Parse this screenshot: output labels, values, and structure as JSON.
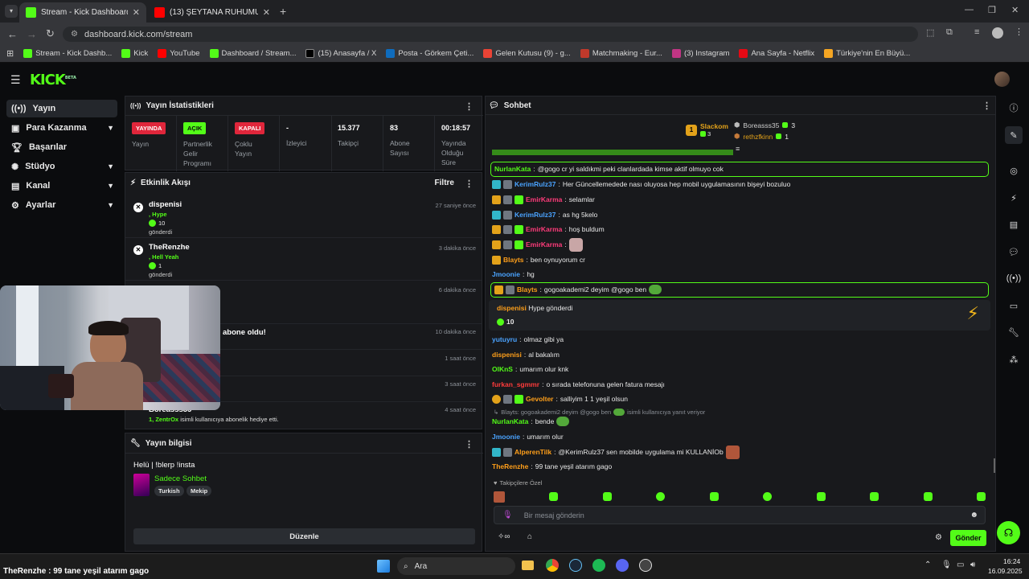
{
  "browser": {
    "tabs": [
      {
        "title": "Stream - Kick Dashboard",
        "active": true
      },
      {
        "title": "(13) ŞEYTANA RUHUMUZU SAT",
        "active": false
      }
    ],
    "url": "dashboard.kick.com/stream",
    "bookmarks": [
      "Stream - Kick Dashb...",
      "Kick",
      "YouTube",
      "Dashboard / Stream...",
      "(15) Anasayfa / X",
      "Posta - Görkem Çeti...",
      "Gelen Kutusu (9) - g...",
      "Matchmaking - Eur...",
      "(3) Instagram",
      "Ana Sayfa - Netflix",
      "Türkiye'nin En Büyü..."
    ]
  },
  "kick": {
    "logo": "KICK",
    "logo_tag": "BETA",
    "colors": {
      "accent": "#53fc18",
      "live": "#e0263b",
      "bg": "#0b0c0e",
      "panel": "#18191c"
    }
  },
  "sidebar": {
    "items": [
      {
        "label": "Yayın",
        "icon": "broadcast-icon"
      },
      {
        "label": "Para Kazanma",
        "icon": "money-icon"
      },
      {
        "label": "Başarılar",
        "icon": "trophy-icon"
      },
      {
        "label": "Stüdyo",
        "icon": "studio-icon"
      },
      {
        "label": "Kanal",
        "icon": "channel-icon"
      },
      {
        "label": "Ayarlar",
        "icon": "gear-icon"
      }
    ]
  },
  "stats": {
    "title": "Yayın İstatistikleri",
    "items": [
      {
        "value": "YAYINDA",
        "label": "Yayın"
      },
      {
        "value": "AÇIK",
        "label": "Partnerlik Gelir Programı"
      },
      {
        "value": "KAPALI",
        "label": "Çoklu Yayın"
      },
      {
        "value": "-",
        "label": "İzleyici"
      },
      {
        "value": "15.377",
        "label": "Takipçi"
      },
      {
        "value": "83",
        "label": "Abone Sayısı"
      },
      {
        "value": "00:18:57",
        "label": "Yayında Olduğu Süre"
      }
    ]
  },
  "activity": {
    "title": "Etkinlik Akışı",
    "filter": "Filtre",
    "events": [
      {
        "name": "dispenisi",
        "emote": ", Hype",
        "amount": "10",
        "sent": "gönderdi",
        "time": "27 saniye önce"
      },
      {
        "name": "TheRenzhe",
        "emote": ", Hell Yeah",
        "amount": "1",
        "sent": "gönderdi",
        "time": "3 dakika önce"
      },
      {
        "time": "6 dakika önce"
      },
      {
        "text": "abone oldu!",
        "time": "10 dakika önce"
      },
      {
        "time": "1 saat önce"
      },
      {
        "time": "3 saat önce"
      },
      {
        "name": "Boreasss35",
        "gift_text": "isimli kullanıcıya abonelik hediye etti.",
        "gift_prefix": "1, ZentrOx",
        "time": "4 saat önce"
      }
    ]
  },
  "info": {
    "title": "Yayın bilgisi",
    "stream_title": "Helü | !blerp !insta",
    "category": "Sadece Sohbet",
    "tags": [
      "Turkish",
      "Mekip"
    ],
    "edit": "Düzenle"
  },
  "chat": {
    "title": "Sohbet",
    "leaderboard": [
      {
        "rank": "1",
        "name": "Slackom",
        "count": "3"
      },
      {
        "name": "Boreasss35",
        "count": "3"
      },
      {
        "name": "rethzfkinn",
        "count": "1"
      }
    ],
    "messages": [
      {
        "user": "NurlanKata",
        "color": "#53fc18",
        "text": "@gogo cr yi saldıkmi peki clanlardada kimse aktif olmuyo cok",
        "highlight": true
      },
      {
        "user": "KerimRulz37",
        "color": "#4aa3ff",
        "text": "Her Güncellemedede nası oluyosa hep mobil uygulamasının bişeyi bozuluo"
      },
      {
        "user": "EmirKarma",
        "color": "#ff3b7a",
        "text": "selamlar"
      },
      {
        "user": "KerimRulz37",
        "color": "#4aa3ff",
        "text": "as hg 5kelo"
      },
      {
        "user": "EmirKarma",
        "color": "#ff3b7a",
        "text": "hoş buldum"
      },
      {
        "user": "EmirKarma",
        "color": "#ff3b7a",
        "text": ""
      },
      {
        "user": "Blayts",
        "color": "#ff9f1a",
        "text": "ben oynuyorum cr"
      },
      {
        "user": "Jmoonie",
        "color": "#4aa3ff",
        "text": "hg"
      },
      {
        "user": "Blayts",
        "color": "#ff9f1a",
        "text": "gogoakademi2 deyim @gogo ben",
        "highlight": true
      },
      {
        "user": "yutuyru",
        "color": "#4aa3ff",
        "text": "olmaz gibi ya"
      },
      {
        "user": "dispenisi",
        "color": "#ff9f1a",
        "text": "al bakalım"
      },
      {
        "user": "OlKnS",
        "color": "#53fc18",
        "text": "umarım olur knk"
      },
      {
        "user": "furkan_sgmmr",
        "color": "#ff3b3b",
        "text": "o sırada telefonuna gelen fatura mesajı"
      },
      {
        "user": "Gevolter",
        "color": "#ff9f1a",
        "text": "salliyim 1 1 yeşil olsun"
      },
      {
        "user": "NurlanKata",
        "color": "#53fc18",
        "text": "bende"
      },
      {
        "user": "Jmoonie",
        "color": "#4aa3ff",
        "text": "umarım olur"
      },
      {
        "user": "AlperenTilk",
        "color": "#ff9f1a",
        "text": "@KerimRulz37 sen mobilde uygulama mi KULLANİOb"
      },
      {
        "user": "TheRenzhe",
        "color": "#ff9f1a",
        "text": "99 tane yeşil atarım gago"
      }
    ],
    "gift": {
      "user": "dispenisi",
      "text": "Hype gönderdi",
      "amount": "10"
    },
    "reply": {
      "text": "Blayts: gogoakademi2 deyim @gogo ben",
      "suffix": "isimli kullanıcıya yanıt veriyor"
    },
    "followers_only": "Takipçilere Özel",
    "placeholder": "Bir mesaj gönderin",
    "send": "Gönder"
  },
  "taskbar": {
    "search": "Ara",
    "time": "16:24",
    "date": "16.09.2025",
    "overlay": "TheRenzhe : 99 tane yeşil atarım gago"
  }
}
